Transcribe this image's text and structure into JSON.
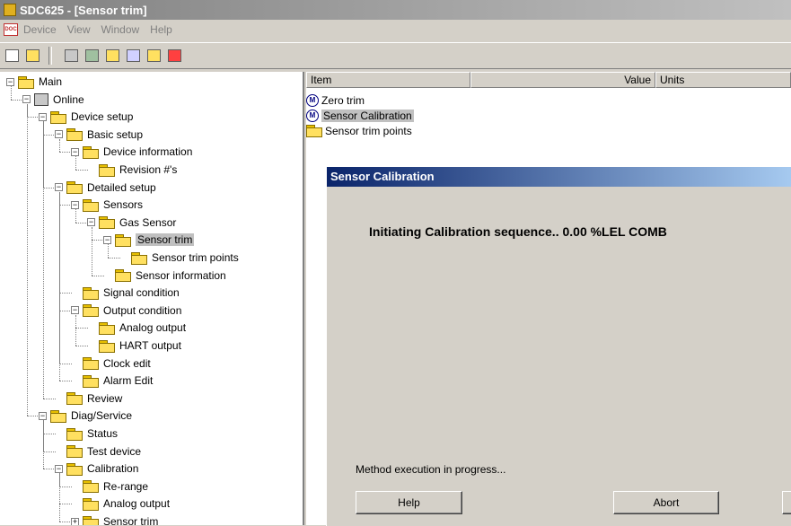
{
  "window": {
    "title": "SDC625 - [Sensor trim]"
  },
  "menu": {
    "items": [
      "Device",
      "View",
      "Window",
      "Help"
    ]
  },
  "toolbar": {
    "buttons": [
      "new-icon",
      "open-icon",
      "device-icon",
      "network-icon",
      "import-icon",
      "export-icon",
      "upload-icon",
      "stop-icon"
    ]
  },
  "tree": {
    "nodes": [
      {
        "label": "Main",
        "depth": 0,
        "expander": "minus",
        "icon": "folder"
      },
      {
        "label": "Online",
        "depth": 1,
        "expander": "minus",
        "icon": "online"
      },
      {
        "label": "Device setup",
        "depth": 2,
        "expander": "minus",
        "icon": "folder"
      },
      {
        "label": "Basic setup",
        "depth": 3,
        "expander": "minus",
        "icon": "folder"
      },
      {
        "label": "Device information",
        "depth": 4,
        "expander": "minus",
        "icon": "folder"
      },
      {
        "label": "Revision #'s",
        "depth": 5,
        "expander": "",
        "icon": "folder"
      },
      {
        "label": "Detailed setup",
        "depth": 3,
        "expander": "minus",
        "icon": "folder"
      },
      {
        "label": "Sensors",
        "depth": 4,
        "expander": "minus",
        "icon": "folder"
      },
      {
        "label": "Gas Sensor",
        "depth": 5,
        "expander": "minus",
        "icon": "folder"
      },
      {
        "label": "Sensor trim",
        "depth": 6,
        "expander": "minus",
        "icon": "folder-open",
        "selected": true
      },
      {
        "label": "Sensor trim points",
        "depth": 7,
        "expander": "",
        "icon": "folder"
      },
      {
        "label": "Sensor information",
        "depth": 6,
        "expander": "",
        "icon": "folder"
      },
      {
        "label": "Signal condition",
        "depth": 4,
        "expander": "",
        "icon": "folder"
      },
      {
        "label": "Output condition",
        "depth": 4,
        "expander": "minus",
        "icon": "folder"
      },
      {
        "label": "Analog output",
        "depth": 5,
        "expander": "",
        "icon": "folder"
      },
      {
        "label": "HART output",
        "depth": 5,
        "expander": "",
        "icon": "folder"
      },
      {
        "label": "Clock edit",
        "depth": 4,
        "expander": "",
        "icon": "folder"
      },
      {
        "label": "Alarm Edit",
        "depth": 4,
        "expander": "",
        "icon": "folder"
      },
      {
        "label": "Review",
        "depth": 3,
        "expander": "",
        "icon": "folder"
      },
      {
        "label": "Diag/Service",
        "depth": 2,
        "expander": "minus",
        "icon": "folder"
      },
      {
        "label": "Status",
        "depth": 3,
        "expander": "",
        "icon": "folder"
      },
      {
        "label": "Test device",
        "depth": 3,
        "expander": "",
        "icon": "folder"
      },
      {
        "label": "Calibration",
        "depth": 3,
        "expander": "minus",
        "icon": "folder"
      },
      {
        "label": "Re-range",
        "depth": 4,
        "expander": "",
        "icon": "folder"
      },
      {
        "label": "Analog output",
        "depth": 4,
        "expander": "",
        "icon": "folder"
      },
      {
        "label": "Sensor trim",
        "depth": 4,
        "expander": "plus",
        "icon": "folder"
      }
    ]
  },
  "list": {
    "columns": [
      "Item",
      "Value",
      "Units"
    ],
    "rows": [
      {
        "label": "Zero trim",
        "icon": "method-icon"
      },
      {
        "label": "Sensor Calibration",
        "icon": "method-icon",
        "selected": true
      },
      {
        "label": "Sensor trim points",
        "icon": "folder-icon"
      }
    ]
  },
  "dialog": {
    "title": "Sensor Calibration",
    "message": "Initiating Calibration sequence..  0.00 %LEL COMB",
    "status": "Method execution in progress...",
    "help_label": "Help",
    "abort_label": "Abort"
  },
  "colors": {
    "selection": "#c0c0c0",
    "dialog_title_start": "#0a246a",
    "dialog_title_end": "#a6caf0"
  }
}
